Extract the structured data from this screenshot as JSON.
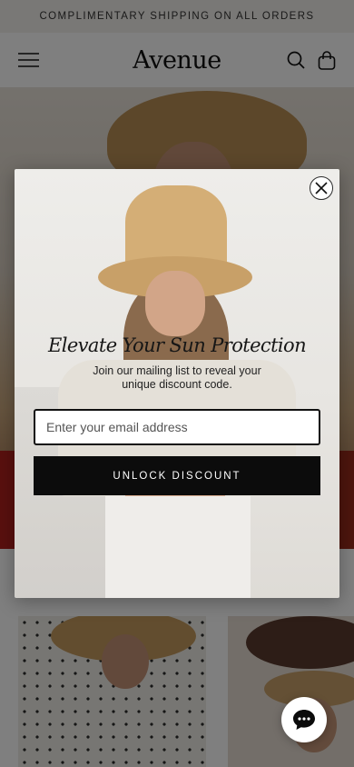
{
  "announcement": {
    "text": "COMPLIMENTARY SHIPPING ON ALL ORDERS"
  },
  "header": {
    "logo": "Avenue",
    "icons": [
      "menu-icon",
      "search-icon",
      "bag-icon"
    ]
  },
  "popup": {
    "title": "Elevate Your Sun Protection",
    "subtitle": "Join our mailing list to reveal your unique discount code.",
    "email_placeholder": "Enter your email address",
    "email_value": "",
    "button_label": "UNLOCK DISCOUNT",
    "close_icon": "close-icon"
  },
  "chat": {
    "icon": "chat-icon"
  },
  "colors": {
    "announcement_bg": "#f3f1ec",
    "button_bg": "#0c0c0c",
    "button_text": "#ffffff",
    "overlay": "rgba(0,0,0,0.5)"
  }
}
